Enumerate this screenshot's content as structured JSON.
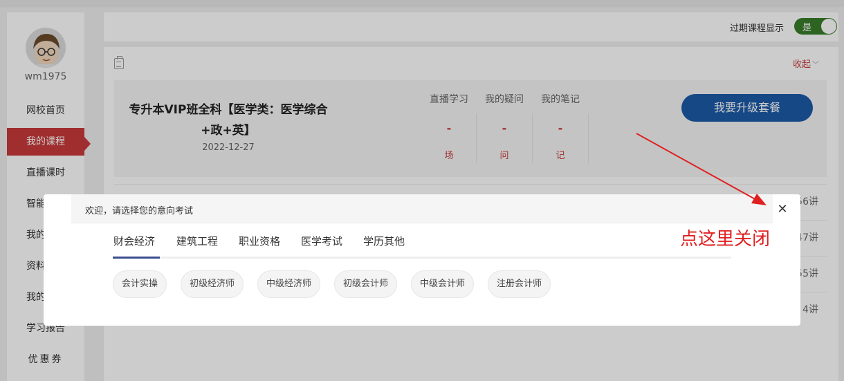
{
  "user": {
    "name": "wm1975"
  },
  "sidebar": {
    "items": [
      {
        "label": "网校首页"
      },
      {
        "label": "我的课程"
      },
      {
        "label": "直播课时"
      },
      {
        "label": "智能"
      },
      {
        "label": "我的"
      },
      {
        "label": "资料"
      },
      {
        "label": "我的"
      },
      {
        "label": "学习报告"
      },
      {
        "label": "优惠券"
      }
    ]
  },
  "header": {
    "expired_label": "过期课程显示",
    "toggle_value": "是"
  },
  "course": {
    "collapse_label": "收起",
    "title": "专升本VIP班全科【医学类：医学综合+政+英】",
    "date": "2022-12-27",
    "stats": [
      {
        "label": "直播学习",
        "value": "-",
        "unit": "场"
      },
      {
        "label": "我的疑问",
        "value": "-",
        "unit": "问"
      },
      {
        "label": "我的笔记",
        "value": "-",
        "unit": "记"
      }
    ],
    "upgrade_button": "我要升级套餐",
    "lesson_counts": [
      "56讲",
      "47讲",
      "55讲",
      "4讲"
    ]
  },
  "modal": {
    "welcome": "欢迎，请选择您的意向考试",
    "close_symbol": "✕",
    "tabs": [
      "财会经济",
      "建筑工程",
      "职业资格",
      "医学考试",
      "学历其他"
    ],
    "chips": [
      "会计实操",
      "初级经济师",
      "中级经济师",
      "初级会计师",
      "中级会计师",
      "注册会计师"
    ]
  },
  "annotation": {
    "text": "点这里关闭",
    "color": "#e02020"
  },
  "colors": {
    "accent_red": "#c83a3a",
    "primary_blue": "#1c5aa8",
    "toggle_green": "#3a7d2a",
    "tab_underline": "#3a4d8f"
  }
}
